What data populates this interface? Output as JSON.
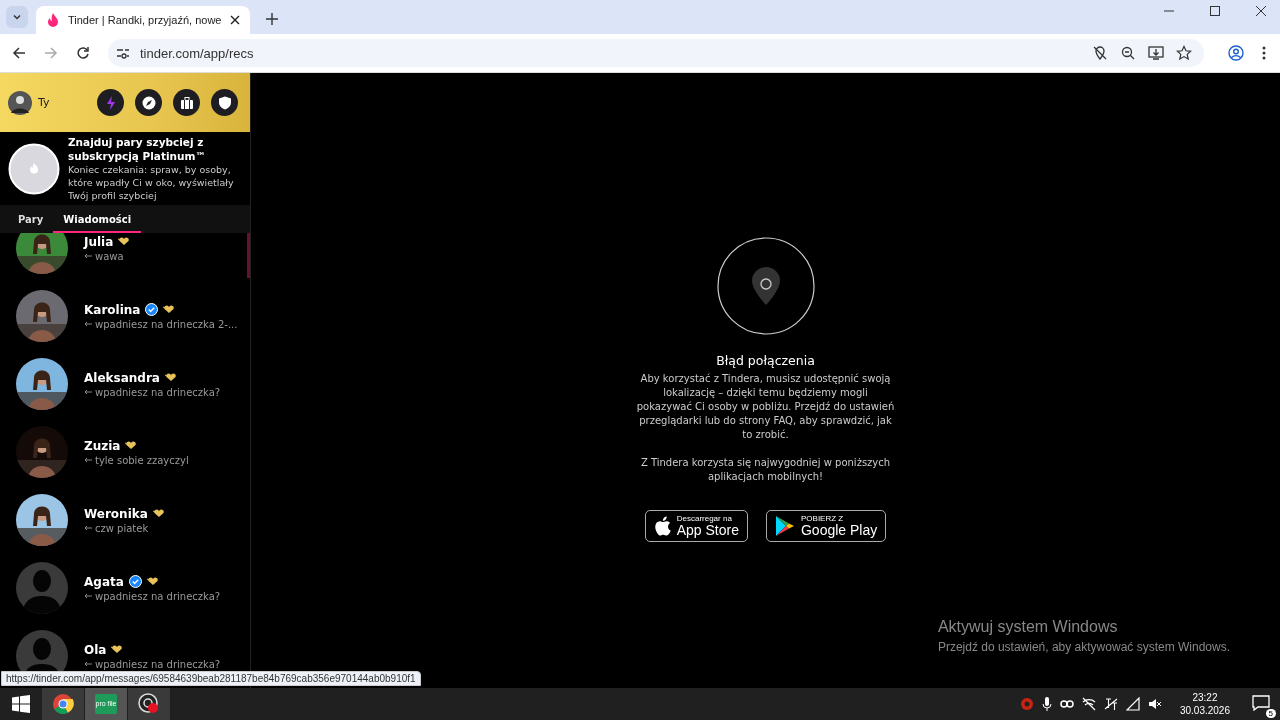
{
  "browser": {
    "tab_title": "Tinder | Randki, przyjaźń, nowe",
    "url": "tinder.com/app/recs"
  },
  "sidebar": {
    "user": "Ty",
    "promo": {
      "title": "Znajduj pary szybciej z subskrypcją Platinum™",
      "text": "Koniec czekania: spraw, by osoby, które wpadły Ci w oko, wyświetlały Twój profil szybciej"
    },
    "tabs": [
      {
        "label": "Pary",
        "selected": false
      },
      {
        "label": "Wiadomości",
        "selected": true
      }
    ],
    "conversations": [
      {
        "name": "Julia",
        "verified": false,
        "message": "wawa"
      },
      {
        "name": "Karolina",
        "verified": true,
        "message": "wpadniesz na drineczka 2-..."
      },
      {
        "name": "Aleksandra",
        "verified": false,
        "message": "wpadniesz na drineczka?"
      },
      {
        "name": "Zuzia",
        "verified": false,
        "message": "tyle sobie zzayczyl"
      },
      {
        "name": "Weronika",
        "verified": false,
        "message": "czw piatek"
      },
      {
        "name": "Agata",
        "verified": true,
        "kind": "silhouette",
        "message": "wpadniesz na drineczka?"
      },
      {
        "name": "Ola",
        "verified": false,
        "kind": "silhouette",
        "message": "wpadniesz na drineczka?"
      }
    ]
  },
  "main": {
    "title": "Błąd połączenia",
    "text": "Aby korzystać z Tindera, musisz udostępnić swoją lokalizację – dzięki temu będziemy mogli pokazywać Ci osoby w pobliżu. Przejdź do ustawień przeglądarki lub do strony FAQ, aby sprawdzić, jak to zrobić.",
    "apps_text": "Z Tindera korzysta się najwygodniej w poniższych aplikacjach mobilnych!",
    "stores": [
      {
        "kind": "apple",
        "small": "Descarregar na",
        "big": "App Store"
      },
      {
        "kind": "google",
        "small": "POBIERZ Z",
        "big": "Google Play"
      }
    ]
  },
  "status_url": "https://tinder.com/app/messages/69584639beab281187be84b769cab356e970144ab0b910f1",
  "activation": {
    "title": "Aktywuj system Windows",
    "text": "Przejdź do ustawień, aby aktywować system Windows."
  },
  "taskbar": {
    "app_label": "pro file",
    "time": "23:22",
    "date": "30.03.2026",
    "notifications": "5"
  }
}
